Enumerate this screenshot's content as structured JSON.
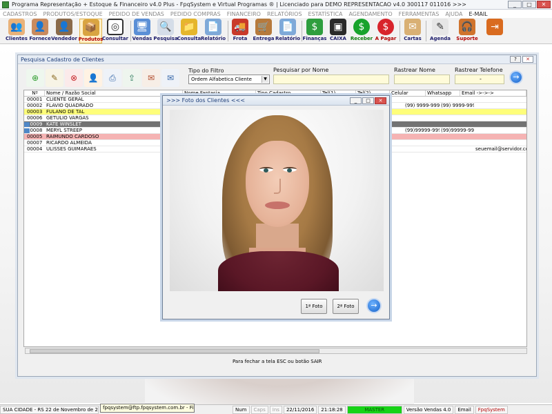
{
  "window": {
    "title": "Programa Representação + Estoque & Financeiro v4.0 Plus - FpqSystem e Virtual Programas ® | Licenciado para  DEMO REPRESENTACAO v4.0 300117 011016 >>>",
    "min": "_",
    "max": "□",
    "close": "✕"
  },
  "menu": [
    "CADASTROS",
    "PRODUTOS/ESTOQUE",
    "PEDIDO DE VENDAS",
    "PEDIDO COMPRAS",
    "FINANCEIRO",
    "RELATÓRIOS",
    "ESTATÍSTICA",
    "AGENDAMENTO",
    "FERRAMENTAS",
    "AJUDA",
    "E-MAIL"
  ],
  "toolbar": [
    {
      "label": "Clientes",
      "icon": "clients-icon"
    },
    {
      "label": "Fornece",
      "icon": "supplier-icon"
    },
    {
      "label": "Vendedor",
      "icon": "seller-icon"
    },
    {
      "label": "Produtos",
      "icon": "products-icon"
    },
    {
      "label": "Consultar",
      "icon": "consult-icon"
    },
    {
      "label": "Vendas",
      "icon": "sales-icon"
    },
    {
      "label": "Pesquisa",
      "icon": "search-icon"
    },
    {
      "label": "Consulta",
      "icon": "query-icon"
    },
    {
      "label": "Relatório",
      "icon": "report-icon"
    },
    {
      "label": "Frota",
      "icon": "fleet-icon"
    },
    {
      "label": "Entrega",
      "icon": "delivery-icon"
    },
    {
      "label": "Relatório",
      "icon": "report2-icon"
    },
    {
      "label": "Finanças",
      "icon": "finance-icon"
    },
    {
      "label": "CAIXA",
      "icon": "cash-icon"
    },
    {
      "label": "Receber",
      "icon": "receive-icon"
    },
    {
      "label": "A Pagar",
      "icon": "pay-icon"
    },
    {
      "label": "Cartas",
      "icon": "letters-icon"
    },
    {
      "label": "Agenda",
      "icon": "agenda-icon"
    },
    {
      "label": "Suporte",
      "icon": "support-icon"
    },
    {
      "label": "",
      "icon": "exit-icon"
    }
  ],
  "pesquisa": {
    "title": "Pesquisa Cadastro de Clientes",
    "help": "?",
    "close": "✕",
    "filter_label": "Tipo do Filtro",
    "filter_value": "Ordem Alfabetica Cliente",
    "search_label": "Pesquisar por Nome",
    "search_value": "",
    "track_name_label": "Rastrear Nome",
    "track_name_value": "",
    "track_phone_label": "Rastrear Telefone",
    "track_phone_value": "-",
    "go": "→",
    "columns": [
      "Nº",
      "Nome / Razão Social",
      "Nome Fantasia",
      "Tipo Cadastro",
      "Tel(1)",
      "Tel(2)",
      "Celular",
      "Whatsapp",
      "Email ->->->"
    ],
    "rows": [
      {
        "num": "00001",
        "name": "CLIENTE GERAL",
        "cel": "",
        "whatsapp": "",
        "email": "",
        "style": ""
      },
      {
        "num": "00002",
        "name": "FLAVIO QUADRADO",
        "cel": "(99) 9999-9999",
        "whatsapp": "(99) 9999-9999",
        "email": "",
        "style": ""
      },
      {
        "num": "00003",
        "name": "FULANO DE TAL",
        "cel": "",
        "whatsapp": "",
        "email": "",
        "style": "yellow"
      },
      {
        "num": "00006",
        "name": "GETULIO VARGAS",
        "cel": "",
        "whatsapp": "",
        "email": "",
        "style": ""
      },
      {
        "num": "00009",
        "name": "KATE WINSLET",
        "cel": "",
        "whatsapp": "",
        "email": "",
        "style": "gray"
      },
      {
        "num": "00008",
        "name": "MERYL STREEP",
        "cel": "(99)99999-9999",
        "whatsapp": "(99)99999-9999",
        "email": "",
        "style": ""
      },
      {
        "num": "00005",
        "name": "RAIMUNDO CARDOSO",
        "cel": "",
        "whatsapp": "",
        "email": "",
        "style": "pink"
      },
      {
        "num": "00007",
        "name": "RICARDO ALMEIDA",
        "cel": "",
        "whatsapp": "",
        "email": "",
        "style": ""
      },
      {
        "num": "00004",
        "name": "ULISSES GUIMARAES",
        "cel": "",
        "whatsapp": "",
        "email": "seuemail@servidor.com.b",
        "style": ""
      }
    ],
    "footer": "Para fechar a tela ESC ou botão SAIR"
  },
  "foto": {
    "title": ">>> Foto dos Clientes <<<",
    "btn1": "1ª Foto",
    "btn2": "2ª Foto",
    "go": "→"
  },
  "status": {
    "city": "SUA CIDADE - RS 22 de Novembro de 2016 -",
    "tooltip": "fpqsystem@ftp.fpqsystem.com.br - FileZilla",
    "num": "Num",
    "caps": "Caps",
    "ins": "Ins",
    "date": "22/11/2016",
    "time": "21:18:28",
    "master": "MASTER",
    "version": "Versão Vendas 4.0",
    "email": "Email",
    "brand": "FpqSystem"
  }
}
